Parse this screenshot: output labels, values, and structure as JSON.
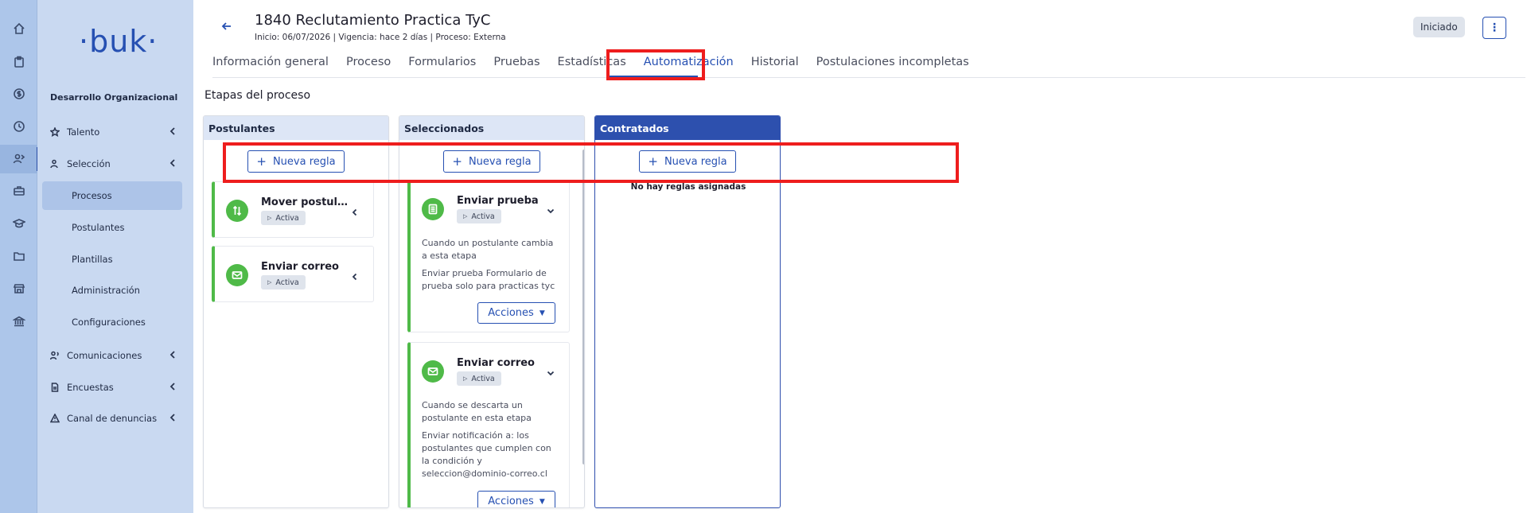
{
  "rail": {
    "icons": [
      "home-icon",
      "clipboard-icon",
      "money-icon",
      "clock-icon",
      "people-icon",
      "briefcase-icon",
      "graduation-icon",
      "folder-icon",
      "store-icon",
      "bank-icon"
    ]
  },
  "sidebar": {
    "logo": "·buk·",
    "org_title": "Desarrollo Organizacional",
    "nav": {
      "talento": "Talento",
      "seleccion": "Selección",
      "comunicaciones": "Comunicaciones",
      "encuestas": "Encuestas",
      "canal": "Canal de denuncias"
    },
    "sub": {
      "procesos": "Procesos",
      "postulantes": "Postulantes",
      "plantillas": "Plantillas",
      "administracion": "Administración",
      "configuraciones": "Configuraciones"
    }
  },
  "header": {
    "title": "1840 Reclutamiento Practica TyC",
    "subtitle": "Inicio: 06/07/2026  | Vigencia: hace 2 días  | Proceso: Externa",
    "status": "Iniciado",
    "menu": "⋮"
  },
  "tabs": {
    "info": "Información general",
    "proceso": "Proceso",
    "formularios": "Formularios",
    "pruebas": "Pruebas",
    "estadisticas": "Estadísticas",
    "automatizacion": "Automatización",
    "historial": "Historial",
    "postulaciones": "Postulaciones incompletas"
  },
  "section_title": "Etapas del proceso",
  "columns": {
    "postulantes": {
      "title": "Postulantes",
      "new_rule": "Nueva regla",
      "cards": [
        {
          "title": "Mover postula...",
          "status": "Activa"
        },
        {
          "title": "Enviar correo",
          "status": "Activa"
        }
      ]
    },
    "seleccionados": {
      "title": "Seleccionados",
      "new_rule": "Nueva regla",
      "cards": [
        {
          "title": "Enviar prueba",
          "status": "Activa",
          "desc1": "Cuando un postulante cambia a esta etapa",
          "desc2": "Enviar prueba Formulario de prueba solo para practicas tyc",
          "actions": "Acciones"
        },
        {
          "title": "Enviar correo",
          "status": "Activa",
          "desc1": "Cuando se descarta un postulante en esta etapa",
          "desc2": "Enviar notificación a: los postulantes que cumplen con la condición y seleccion@dominio-correo.cl",
          "actions": "Acciones"
        }
      ]
    },
    "contratados": {
      "title": "Contratados",
      "new_rule": "Nueva regla",
      "empty": "No hay reglas asignadas"
    }
  }
}
